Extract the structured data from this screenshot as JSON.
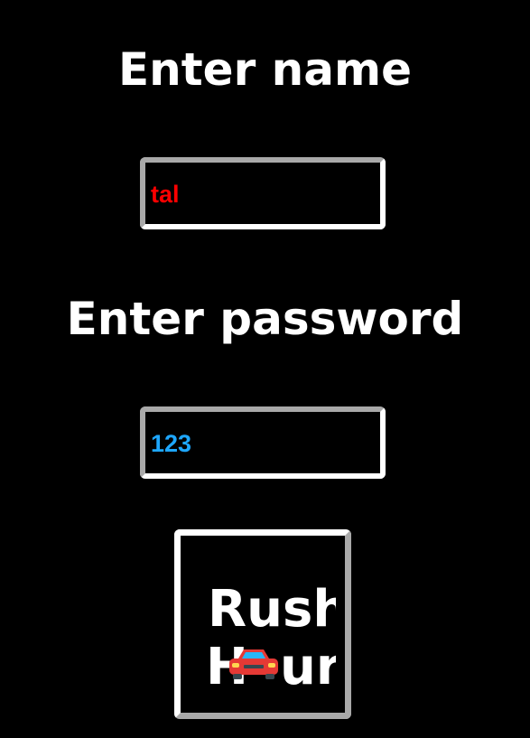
{
  "form": {
    "name_heading": "Enter name",
    "name_value": "tal",
    "password_heading": "Enter password",
    "password_value": "123"
  },
  "logo": {
    "line1": "Rush",
    "line2_start": "H",
    "line2_end": "ur"
  },
  "colors": {
    "background": "#000000",
    "heading": "#ffffff",
    "name_value": "#ff0000",
    "password_value": "#1ea7ff",
    "border_light": "#ffffff",
    "border_dark": "#a9a9a9",
    "car_body": "#e53935",
    "car_window": "#29b6f6"
  },
  "icons": {
    "logo_car": "car-icon"
  }
}
